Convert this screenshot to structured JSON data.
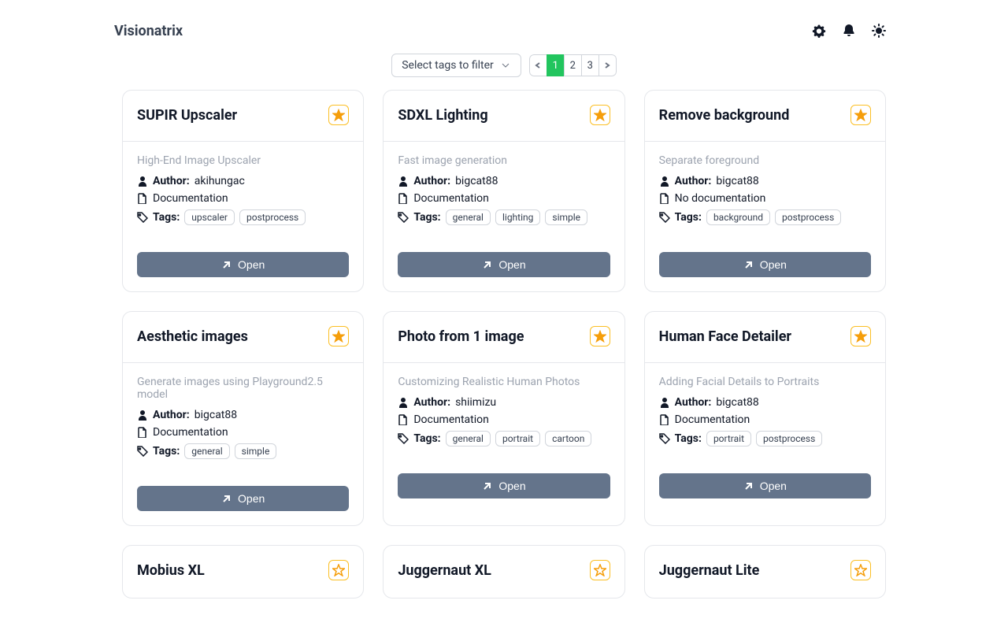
{
  "header": {
    "brand": "Visionatrix"
  },
  "toolbar": {
    "filter_label": "Select tags to filter",
    "pages": [
      "1",
      "2",
      "3"
    ],
    "active_page": 0
  },
  "common": {
    "author_label": "Author:",
    "tags_label": "Tags:",
    "doc_label": "Documentation",
    "no_doc_label": "No documentation",
    "open_label": "Open"
  },
  "cards": [
    {
      "title": "SUPIR Upscaler",
      "starred": true,
      "desc": "High-End Image Upscaler",
      "author": "akihungac",
      "doc": true,
      "tags": [
        "upscaler",
        "postprocess"
      ]
    },
    {
      "title": "SDXL Lighting",
      "starred": true,
      "desc": "Fast image generation",
      "author": "bigcat88",
      "doc": true,
      "tags": [
        "general",
        "lighting",
        "simple"
      ]
    },
    {
      "title": "Remove background",
      "starred": true,
      "desc": "Separate foreground",
      "author": "bigcat88",
      "doc": false,
      "tags": [
        "background",
        "postprocess"
      ]
    },
    {
      "title": "Aesthetic images",
      "starred": true,
      "desc": "Generate images using Playground2.5 model",
      "author": "bigcat88",
      "doc": true,
      "tags": [
        "general",
        "simple"
      ]
    },
    {
      "title": "Photo from 1 image",
      "starred": true,
      "desc": "Customizing Realistic Human Photos",
      "author": "shiimizu",
      "doc": true,
      "tags": [
        "general",
        "portrait",
        "cartoon"
      ]
    },
    {
      "title": "Human Face Detailer",
      "starred": true,
      "desc": "Adding Facial Details to Portraits",
      "author": "bigcat88",
      "doc": true,
      "tags": [
        "portrait",
        "postprocess"
      ]
    },
    {
      "title": "Mobius XL",
      "starred": false
    },
    {
      "title": "Juggernaut XL",
      "starred": false
    },
    {
      "title": "Juggernaut Lite",
      "starred": false
    }
  ]
}
